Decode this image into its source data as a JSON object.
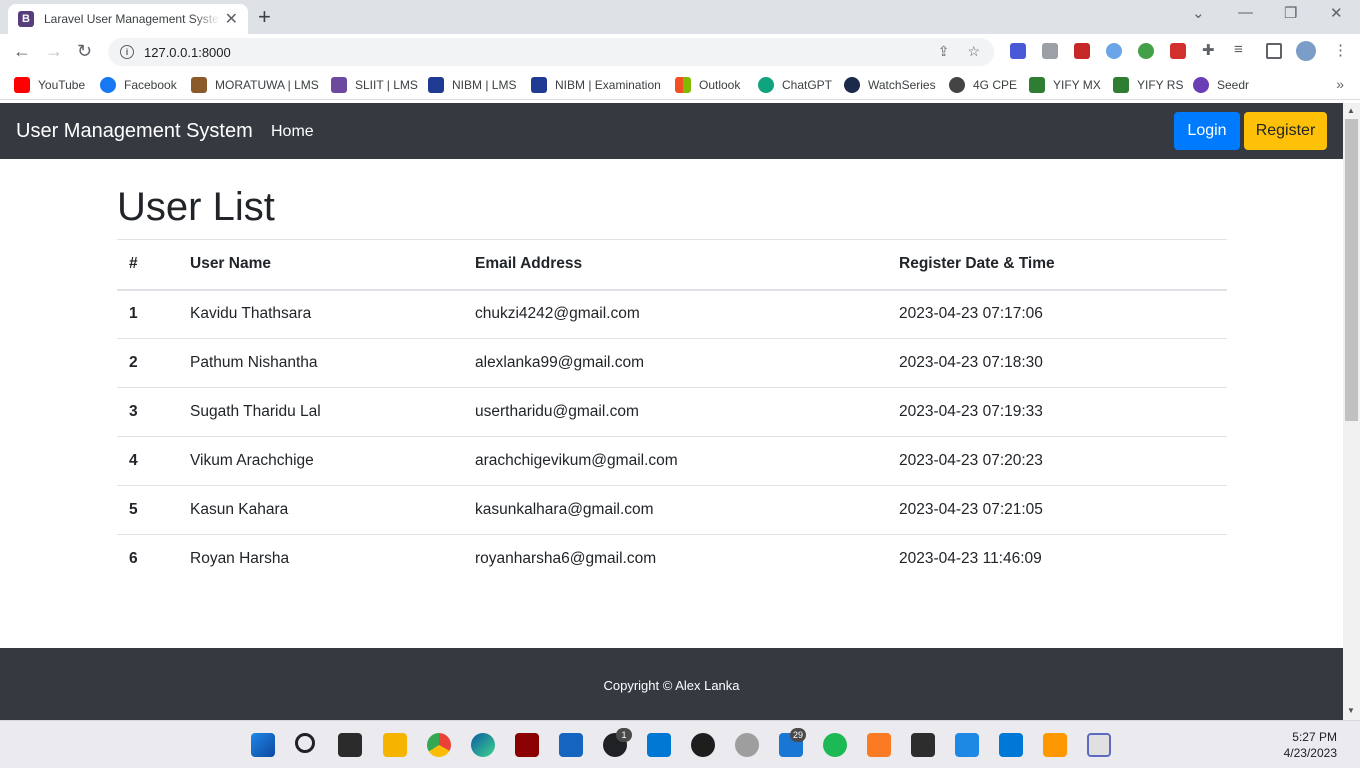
{
  "browser": {
    "tab_title": "Laravel User Management System",
    "tab_favicon_letter": "B",
    "url": "127.0.0.1:8000",
    "bookmarks": [
      {
        "label": "YouTube",
        "color": "#ff0000"
      },
      {
        "label": "Facebook",
        "color": "#1877f2"
      },
      {
        "label": "MORATUWA | LMS",
        "color": "#8b5a2b"
      },
      {
        "label": "SLIIT | LMS",
        "color": "#6b4aa0"
      },
      {
        "label": "NIBM | LMS",
        "color": "#1f3a93"
      },
      {
        "label": "NIBM | Examination",
        "color": "#1f3a93"
      },
      {
        "label": "Outlook",
        "color": "#0078d4"
      },
      {
        "label": "ChatGPT",
        "color": "#10a37f"
      },
      {
        "label": "WatchSeries",
        "color": "#1b2a4a"
      },
      {
        "label": "4G CPE",
        "color": "#444444"
      },
      {
        "label": "YIFY MX",
        "color": "#2e7d32"
      },
      {
        "label": "YIFY RS",
        "color": "#2e7d32"
      },
      {
        "label": "Seedr",
        "color": "#6a3fb5"
      }
    ]
  },
  "app": {
    "brand": "User Management System",
    "nav_home": "Home",
    "login_label": "Login",
    "register_label": "Register",
    "heading": "User List",
    "columns": [
      "#",
      "User Name",
      "Email Address",
      "Register Date & Time"
    ],
    "users": [
      {
        "id": "1",
        "name": "Kavidu Thathsara",
        "email": "chukzi4242@gmail.com",
        "registered": "2023-04-23 07:17:06"
      },
      {
        "id": "2",
        "name": "Pathum Nishantha",
        "email": "alexlanka99@gmail.com",
        "registered": "2023-04-23 07:18:30"
      },
      {
        "id": "3",
        "name": "Sugath Tharidu Lal",
        "email": "usertharidu@gmail.com",
        "registered": "2023-04-23 07:19:33"
      },
      {
        "id": "4",
        "name": "Vikum Arachchige",
        "email": "arachchigevikum@gmail.com",
        "registered": "2023-04-23 07:20:23"
      },
      {
        "id": "5",
        "name": "Kasun Kahara",
        "email": "kasunkalhara@gmail.com",
        "registered": "2023-04-23 07:21:05"
      },
      {
        "id": "6",
        "name": "Royan Harsha",
        "email": "royanharsha6@gmail.com",
        "registered": "2023-04-23 11:46:09"
      }
    ],
    "footer_text": "Copyright © Alex Lanka"
  },
  "taskbar": {
    "badges": {
      "xbox": "1",
      "mail": "29"
    },
    "time": "5:27 PM",
    "date": "4/23/2023"
  },
  "colors": {
    "navbar": "#343a40",
    "primary": "#007bff",
    "warning": "#ffc107"
  }
}
